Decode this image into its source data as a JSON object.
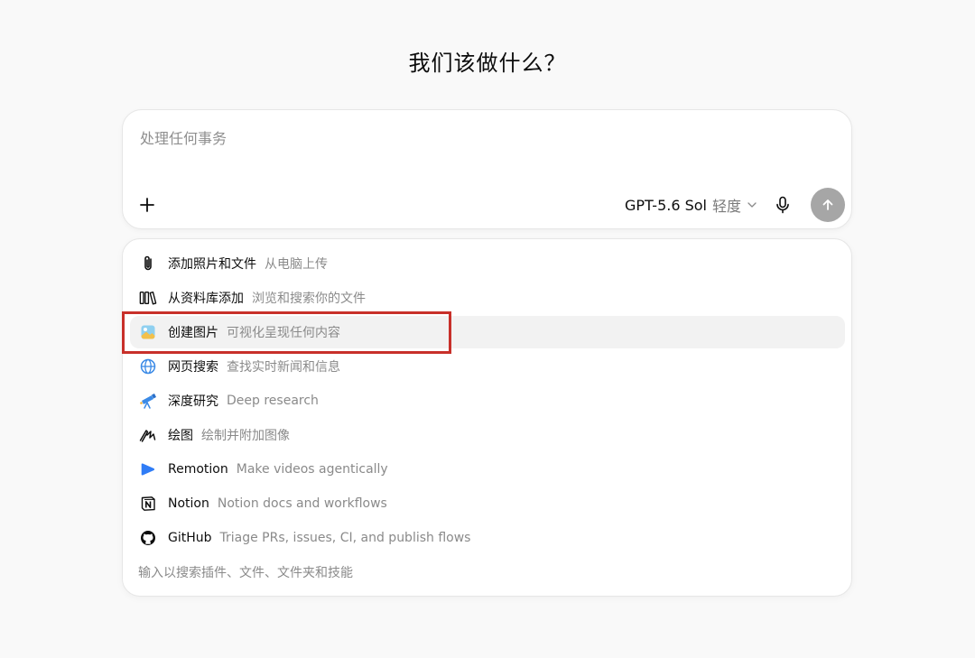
{
  "heading": "我们该做什么？",
  "composer": {
    "placeholder": "处理任何事务",
    "value": "",
    "model_name": "GPT-5.6 Sol",
    "model_level": "轻度"
  },
  "menu": {
    "items": [
      {
        "icon": "paperclip-icon",
        "label": "添加照片和文件",
        "desc": "从电脑上传"
      },
      {
        "icon": "library-icon",
        "label": "从资料库添加",
        "desc": "浏览和搜索你的文件"
      },
      {
        "icon": "image-icon",
        "label": "创建图片",
        "desc": "可视化呈现任何内容",
        "active": true
      },
      {
        "icon": "globe-icon",
        "label": "网页搜索",
        "desc": "查找实时新闻和信息"
      },
      {
        "icon": "telescope-icon",
        "label": "深度研究",
        "desc": "Deep research"
      },
      {
        "icon": "pen-scribble-icon",
        "label": "绘图",
        "desc": "绘制并附加图像"
      },
      {
        "icon": "remotion-icon",
        "label": "Remotion",
        "desc": "Make videos agentically"
      },
      {
        "icon": "notion-icon",
        "label": "Notion",
        "desc": "Notion docs and workflows"
      },
      {
        "icon": "github-icon",
        "label": "GitHub",
        "desc": "Triage PRs, issues, CI, and publish flows"
      }
    ],
    "hint": "输入以搜索插件、文件、文件夹和技能"
  },
  "colors": {
    "highlight": "#c8302a",
    "send_button": "#a6a6a6",
    "globe": "#3b8ae6",
    "remotion": "#2f7cf6"
  }
}
